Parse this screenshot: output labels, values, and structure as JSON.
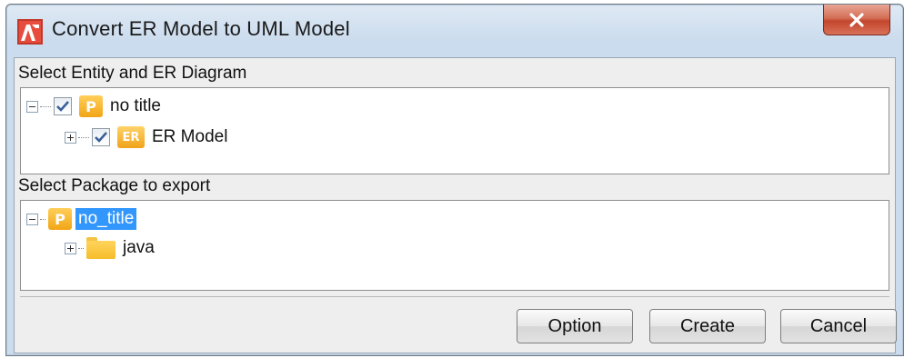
{
  "window": {
    "title": "Convert ER Model to UML Model",
    "app_icon": "astah-icon",
    "close_icon": "close-icon"
  },
  "entity_section": {
    "label": "Select Entity and ER Diagram",
    "tree": [
      {
        "label": "no title",
        "icon_text": "P",
        "checked": true,
        "expanded": true
      },
      {
        "label": "ER Model",
        "icon_text": "ER",
        "checked": true,
        "expanded": false
      }
    ]
  },
  "package_section": {
    "label": "Select Package to export",
    "tree": [
      {
        "label": "no_title",
        "icon_text": "P",
        "selected": true,
        "expanded": true
      },
      {
        "label": "java",
        "icon": "folder-icon",
        "expanded": false
      }
    ]
  },
  "buttons": {
    "option": "Option",
    "create": "Create",
    "cancel": "Cancel"
  },
  "colors": {
    "selection": "#3297fd",
    "package_icon": "#f2a516",
    "close_button": "#c3462c"
  }
}
